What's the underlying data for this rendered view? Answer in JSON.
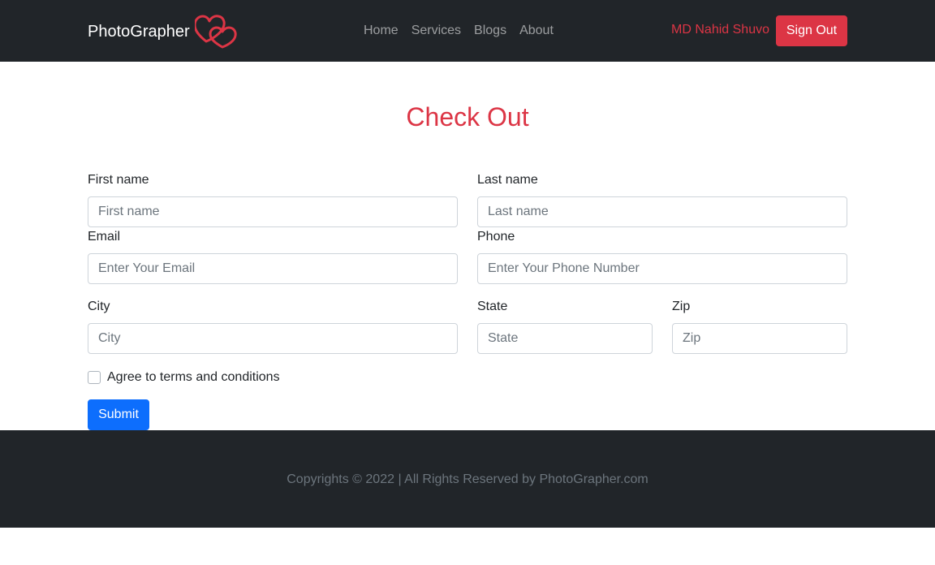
{
  "navbar": {
    "brand": "PhotoGrapher",
    "logo_icon": "double-heart-icon",
    "links": [
      "Home",
      "Services",
      "Blogs",
      "About"
    ],
    "user_name": "MD Nahid Shuvo",
    "signout_label": "Sign Out"
  },
  "page": {
    "title": "Check Out"
  },
  "form": {
    "first_name": {
      "label": "First name",
      "placeholder": "First name",
      "value": ""
    },
    "last_name": {
      "label": "Last name",
      "placeholder": "Last name",
      "value": ""
    },
    "email": {
      "label": "Email",
      "placeholder": "Enter Your Email",
      "value": ""
    },
    "phone": {
      "label": "Phone",
      "placeholder": "Enter Your Phone Number",
      "value": ""
    },
    "city": {
      "label": "City",
      "placeholder": "City",
      "value": ""
    },
    "state": {
      "label": "State",
      "placeholder": "State",
      "value": ""
    },
    "zip": {
      "label": "Zip",
      "placeholder": "Zip",
      "value": ""
    },
    "terms_label": "Agree to terms and conditions",
    "terms_checked": false,
    "submit_label": "Submit"
  },
  "footer": {
    "text": "Copyrights © 2022 | All Rights Reserved by PhotoGrapher.com"
  },
  "colors": {
    "dark": "#212529",
    "accent_red": "#dc3545",
    "primary_blue": "#0d6efd"
  }
}
